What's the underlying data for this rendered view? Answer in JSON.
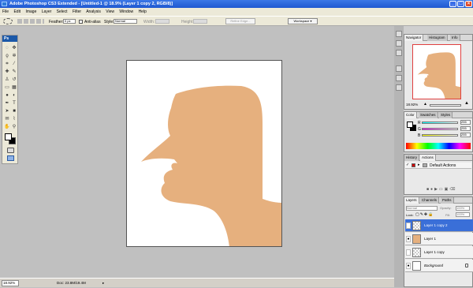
{
  "title": "Adobe Photoshop CS3 Extended - [Untitled-1 @ 18.9% (Layer 1 copy 2, RGB/8)]",
  "menu": [
    "File",
    "Edit",
    "Image",
    "Layer",
    "Select",
    "Filter",
    "Analysis",
    "View",
    "Window",
    "Help"
  ],
  "options": {
    "feather_label": "Feather:",
    "feather_value": "0 px",
    "antialias_label": "Anti-alias",
    "style_label": "Style:",
    "style_value": "Normal",
    "width_label": "Width:",
    "height_label": "Height:",
    "refine_edge": "Refine Edge...",
    "workspace": "Workspace"
  },
  "toolbox": {
    "logo": "Ps"
  },
  "status": {
    "zoom": "18.92%",
    "doc": "Doc: 23.8M/19.4M"
  },
  "navigator": {
    "tabs": [
      "Navigator",
      "Histogram",
      "Info"
    ],
    "zoom": "18.92%",
    "zoom_fraction": 0.42
  },
  "color": {
    "tabs": [
      "Color",
      "Swatches",
      "Styles"
    ],
    "channels": [
      {
        "label": "R",
        "value": "255"
      },
      {
        "label": "G",
        "value": "255"
      },
      {
        "label": "B",
        "value": "255"
      }
    ]
  },
  "history": {
    "tabs": [
      "History",
      "Actions"
    ],
    "item": "Default Actions"
  },
  "layers": {
    "tabs": [
      "Layers",
      "Channels",
      "Paths"
    ],
    "blend_mode": "Normal",
    "opacity_label": "Opacity:",
    "opacity": "100%",
    "lock_label": "Lock:",
    "fill_label": "Fill:",
    "fill": "100%",
    "items": [
      {
        "name": "Layer 1 copy 2",
        "visible": false,
        "selected": true
      },
      {
        "name": "Layer 1",
        "visible": true,
        "selected": false
      },
      {
        "name": "Layer 1 copy",
        "visible": false,
        "selected": false
      },
      {
        "name": "Background",
        "visible": true,
        "selected": false
      }
    ]
  },
  "colors": {
    "skin": "#e6b07e",
    "title_blue": "#1f58d0",
    "selection": "#3a6fd8"
  }
}
